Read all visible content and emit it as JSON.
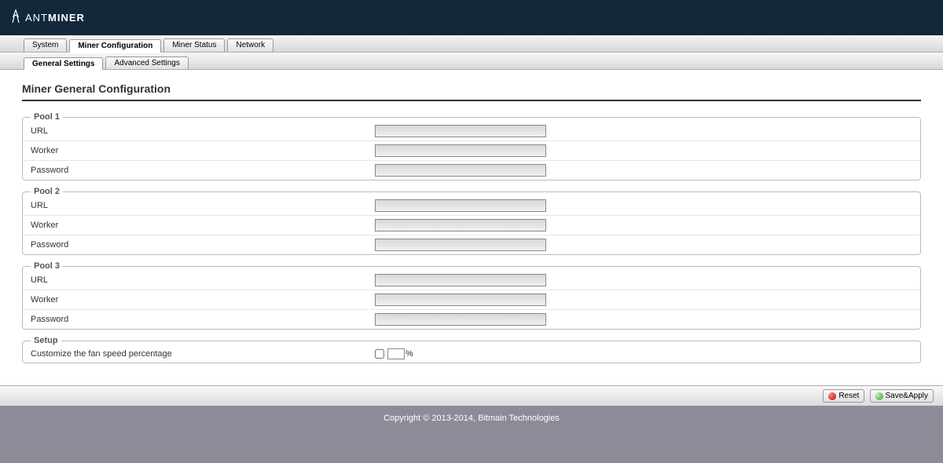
{
  "brand": {
    "prefix": "ANT",
    "suffix": "MINER"
  },
  "tabs": {
    "primary": [
      {
        "label": "System",
        "active": false
      },
      {
        "label": "Miner Configuration",
        "active": true
      },
      {
        "label": "Miner Status",
        "active": false
      },
      {
        "label": "Network",
        "active": false
      }
    ],
    "secondary": [
      {
        "label": "General Settings",
        "active": true
      },
      {
        "label": "Advanced Settings",
        "active": false
      }
    ]
  },
  "page_title": "Miner General Configuration",
  "pools": [
    {
      "legend": "Pool 1",
      "fields": {
        "url": {
          "label": "URL",
          "value": ""
        },
        "worker": {
          "label": "Worker",
          "value": ""
        },
        "password": {
          "label": "Password",
          "value": ""
        }
      }
    },
    {
      "legend": "Pool 2",
      "fields": {
        "url": {
          "label": "URL",
          "value": ""
        },
        "worker": {
          "label": "Worker",
          "value": ""
        },
        "password": {
          "label": "Password",
          "value": ""
        }
      }
    },
    {
      "legend": "Pool 3",
      "fields": {
        "url": {
          "label": "URL",
          "value": ""
        },
        "worker": {
          "label": "Worker",
          "value": ""
        },
        "password": {
          "label": "Password",
          "value": ""
        }
      }
    }
  ],
  "setup": {
    "legend": "Setup",
    "fan_speed": {
      "label": "Customize the fan speed percentage",
      "value": "",
      "suffix": "%"
    }
  },
  "buttons": {
    "reset": "Reset",
    "save_apply": "Save&Apply"
  },
  "footer": "Copyright © 2013-2014, Bitmain Technologies"
}
